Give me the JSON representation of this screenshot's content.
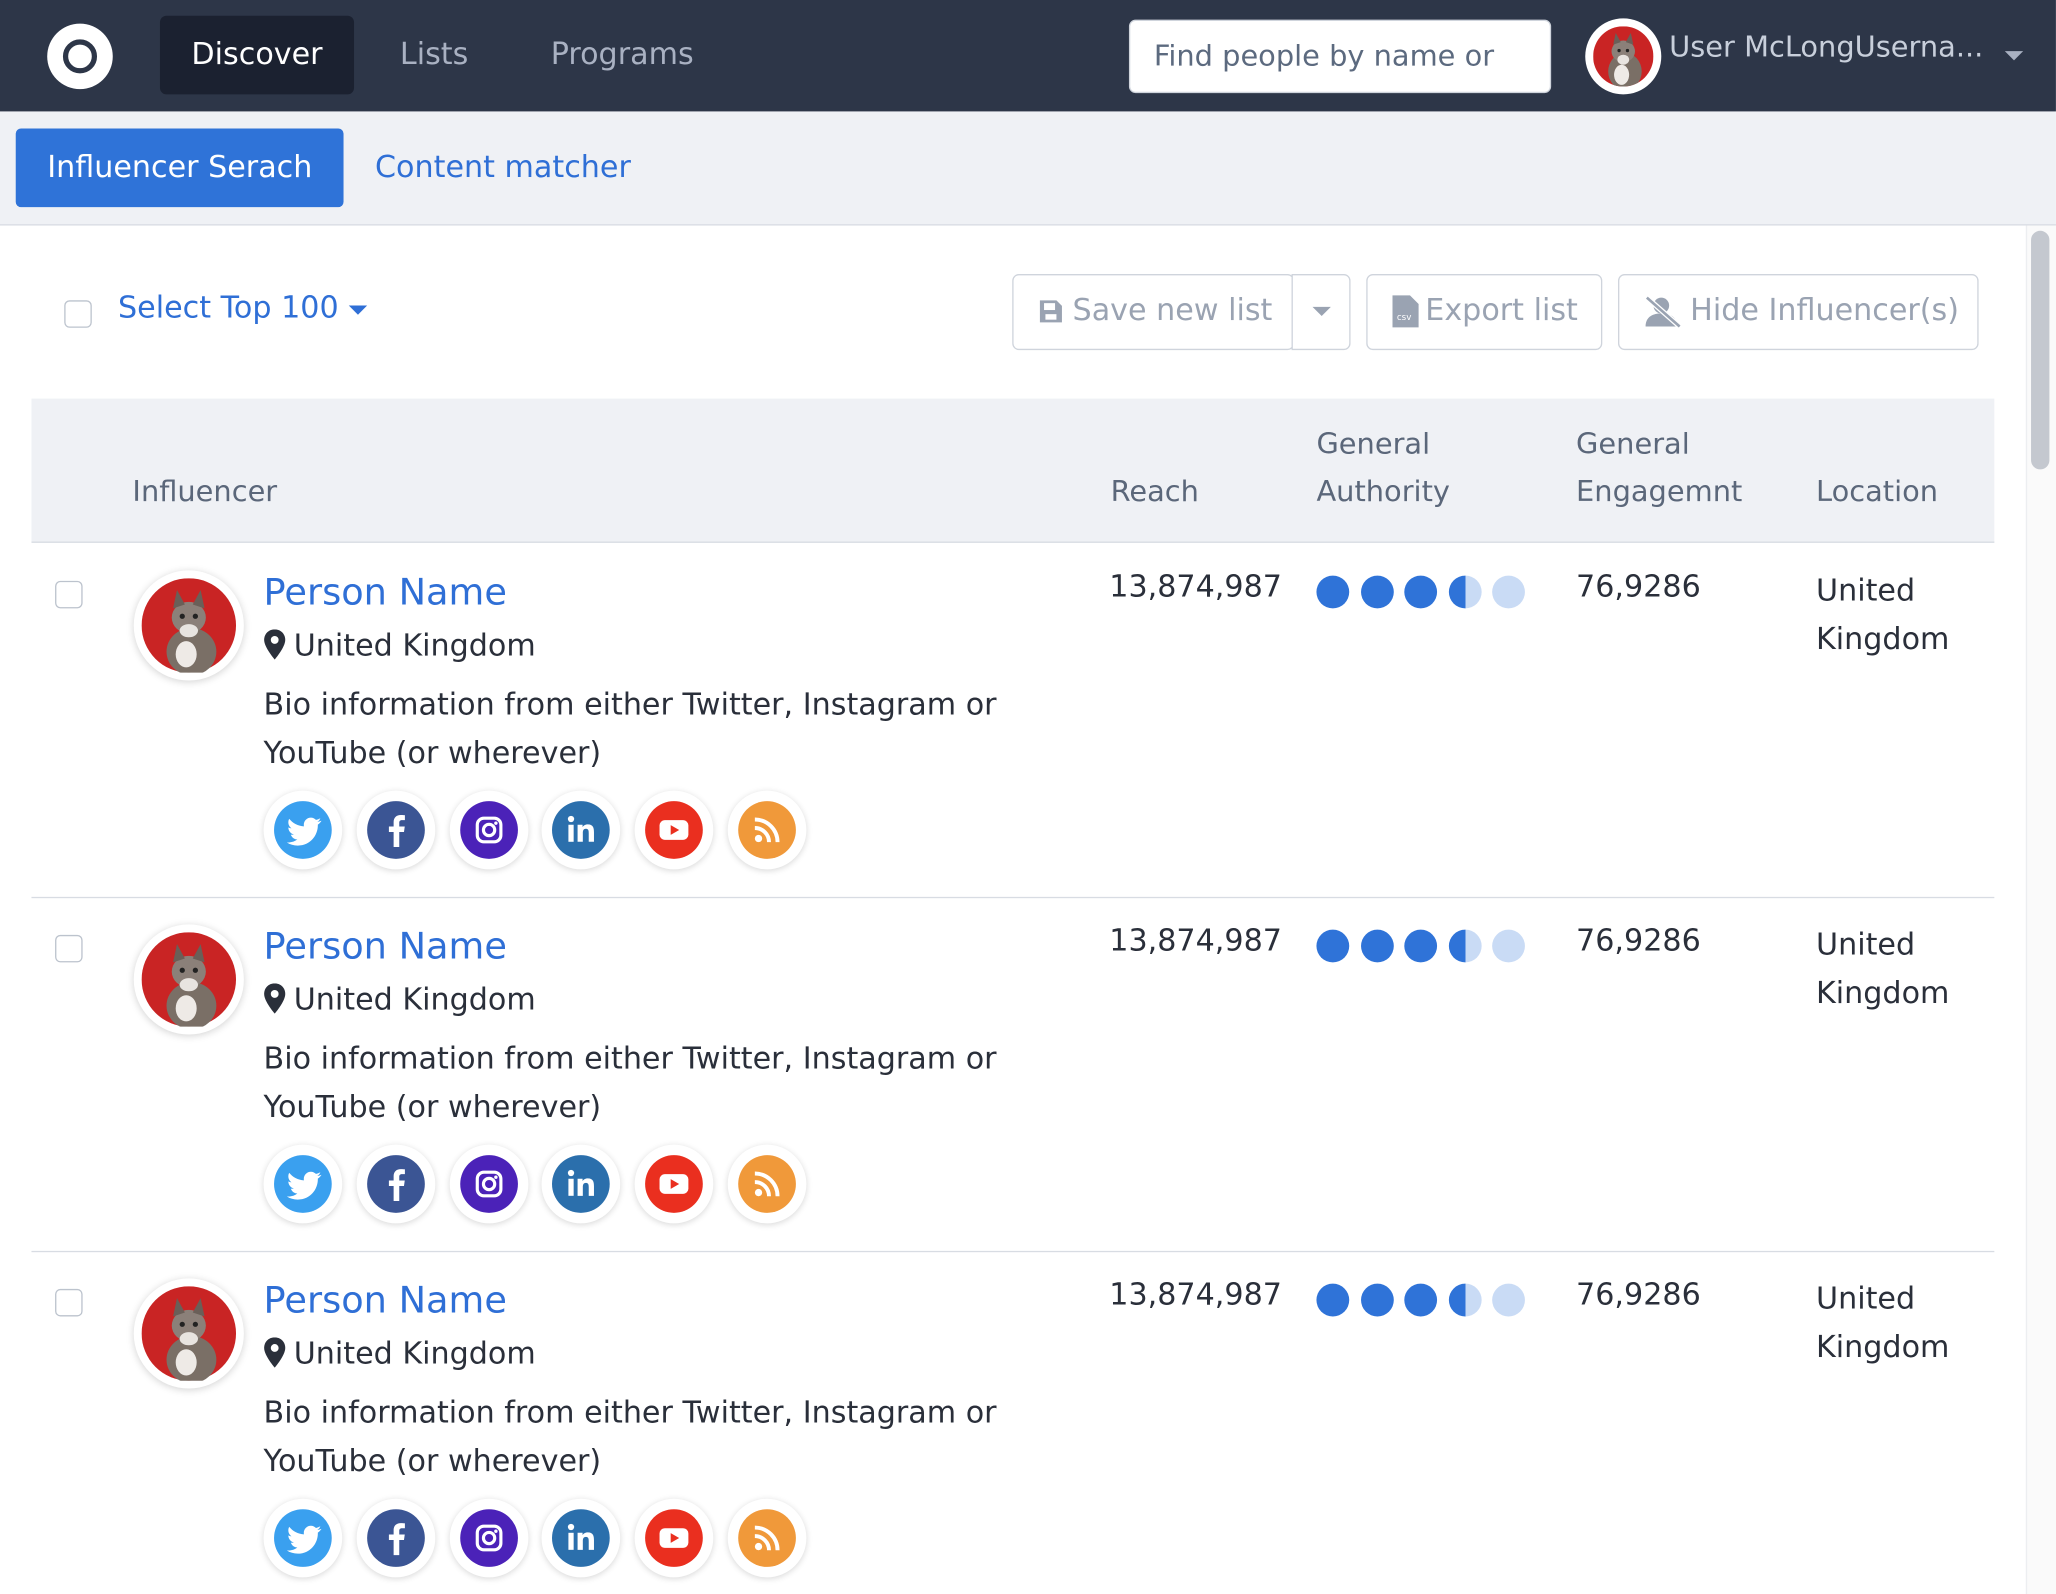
{
  "nav": {
    "tabs": [
      {
        "label": "Discover",
        "active": true
      },
      {
        "label": "Lists",
        "active": false
      },
      {
        "label": "Programs",
        "active": false
      }
    ],
    "search_placeholder": "Find people by name or",
    "user_name": "User McLongUserna...",
    "logo_icon": "circle-logo-icon"
  },
  "subnav": {
    "tabs": [
      {
        "label": "Influencer Serach",
        "active": true
      },
      {
        "label": "Content matcher",
        "active": false
      }
    ]
  },
  "toolbar": {
    "select_top": "Select Top 100",
    "save_label": "Save new list",
    "export_label": "Export list",
    "hide_label": "Hide Influencer(s)"
  },
  "table": {
    "columns": {
      "influencer": "Influencer",
      "reach": "Reach",
      "authority_line1": "General",
      "authority_line2": "Authority",
      "engagement_line1": "General",
      "engagement_line2": "Engagemnt",
      "location": "Location"
    },
    "rows": [
      {
        "name": "Person Name",
        "location": "United Kingdom",
        "bio": "Bio information from either Twitter, Instagram or YouTube (or wherever)",
        "reach": "13,874,987",
        "authority_rating": 3.5,
        "authority_max": 5,
        "engagement": "76,9286",
        "location_col": "United Kingdom",
        "socials": [
          "twitter",
          "facebook",
          "instagram",
          "linkedin",
          "youtube",
          "rss"
        ]
      },
      {
        "name": "Person Name",
        "location": "United Kingdom",
        "bio": "Bio information from either Twitter, Instagram or YouTube (or wherever)",
        "reach": "13,874,987",
        "authority_rating": 3.5,
        "authority_max": 5,
        "engagement": "76,9286",
        "location_col": "United Kingdom",
        "socials": [
          "twitter",
          "facebook",
          "instagram",
          "linkedin",
          "youtube",
          "rss"
        ]
      },
      {
        "name": "Person Name",
        "location": "United Kingdom",
        "bio": "Bio information from either Twitter, Instagram or YouTube (or wherever)",
        "reach": "13,874,987",
        "authority_rating": 3.5,
        "authority_max": 5,
        "engagement": "76,9286",
        "location_col": "United Kingdom",
        "socials": [
          "twitter",
          "facebook",
          "instagram",
          "linkedin",
          "youtube",
          "rss"
        ]
      }
    ]
  },
  "colors": {
    "nav_bg": "#2d3648",
    "accent": "#2f73d8",
    "twitter": "#3aa0ef",
    "facebook": "#3b5594",
    "instagram": "#4b22b8",
    "linkedin": "#2b6fac",
    "youtube": "#ea2f1f",
    "rss": "#f0993a"
  }
}
